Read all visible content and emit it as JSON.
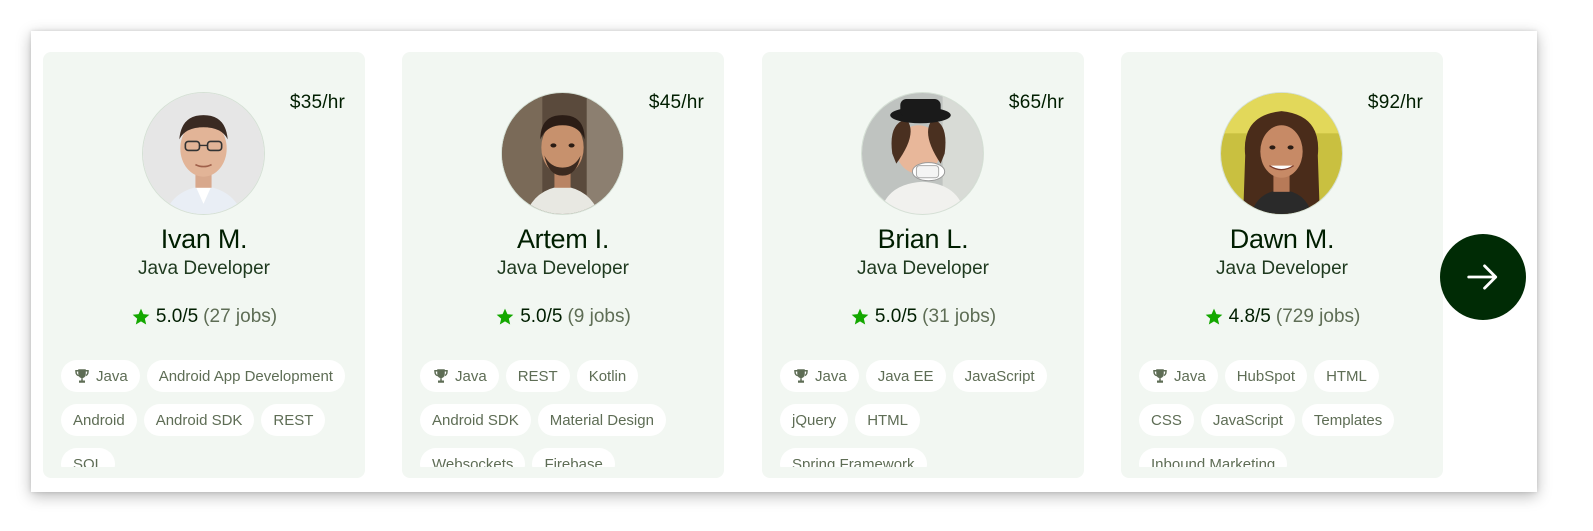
{
  "freelancers": [
    {
      "rate": "$35/hr",
      "name": "Ivan M.",
      "title": "Java Developer",
      "rating": "5.0/5",
      "jobs": "(27 jobs)",
      "skills": [
        "Java",
        "Android App Development",
        "Android",
        "Android SDK",
        "REST",
        "SQL"
      ]
    },
    {
      "rate": "$45/hr",
      "name": "Artem I.",
      "title": "Java Developer",
      "rating": "5.0/5",
      "jobs": "(9 jobs)",
      "skills": [
        "Java",
        "REST",
        "Kotlin",
        "Android SDK",
        "Material Design",
        "Websockets",
        "Firebase"
      ]
    },
    {
      "rate": "$65/hr",
      "name": "Brian L.",
      "title": "Java Developer",
      "rating": "5.0/5",
      "jobs": "(31 jobs)",
      "skills": [
        "Java",
        "Java EE",
        "JavaScript",
        "jQuery",
        "HTML",
        "Spring Framework"
      ]
    },
    {
      "rate": "$92/hr",
      "name": "Dawn M.",
      "title": "Java Developer",
      "rating": "4.8/5",
      "jobs": "(729 jobs)",
      "skills": [
        "Java",
        "HubSpot",
        "HTML",
        "CSS",
        "JavaScript",
        "Templates",
        "Inbound Marketing"
      ]
    }
  ],
  "icons": {
    "star": "star-icon",
    "top_skill": "trophy-icon",
    "next": "arrow-right-icon"
  },
  "colors": {
    "card_bg": "#f2f7f2",
    "star": "#14a800",
    "next_button": "#002b05",
    "muted_text": "#5e6d55"
  }
}
